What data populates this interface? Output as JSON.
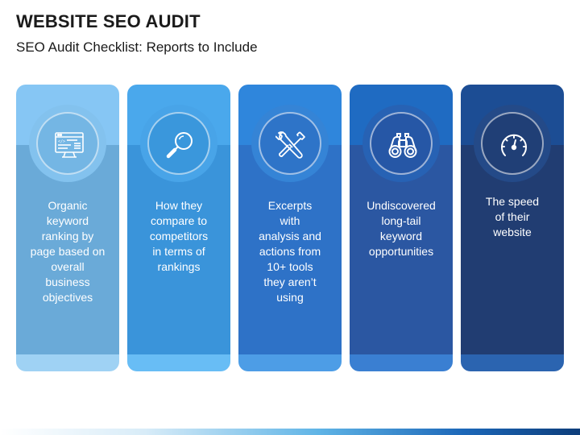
{
  "header": {
    "title": "WEBSITE SEO AUDIT",
    "subtitle": "SEO Audit Checklist: Reports to Include"
  },
  "cards": [
    {
      "text": "Organic\nkeyword\nranking by\npage based on\noverall\nbusiness\nobjectives",
      "icon": "web-code-report-icon",
      "colors": {
        "top": "#86c6f4",
        "body": "#6aaad8",
        "foot": "#9fd2f4",
        "ring": "#83c2ee",
        "circle": "#74b6e4"
      }
    },
    {
      "text": "How they\ncompare to\ncompetitors\nin terms of\nrankings",
      "icon": "magnifier-icon",
      "colors": {
        "top": "#4aa8ec",
        "body": "#3a94da",
        "foot": "#68bdf5",
        "ring": "#48a4e8",
        "circle": "#3a97dc"
      }
    },
    {
      "text": "Excerpts\nwith\nanalysis and\nactions from\n10+ tools\nthey aren’t\nusing",
      "icon": "wrench-screwdriver-icon",
      "colors": {
        "top": "#2f86dc",
        "body": "#2e72c7",
        "foot": "#4d9de6",
        "ring": "#3584d6",
        "circle": "#2e74c8"
      }
    },
    {
      "text": "Undiscovered\nlong-tail\nkeyword\nopportunities",
      "icon": "binoculars-icon",
      "colors": {
        "top": "#1f6bc2",
        "body": "#2b57a2",
        "foot": "#3a7fd2",
        "ring": "#2762b4",
        "circle": "#2657a6"
      }
    },
    {
      "text": "The speed\nof their\nwebsite",
      "icon": "speedometer-icon",
      "colors": {
        "top": "#1c4d94",
        "body": "#213d72",
        "foot": "#2b64b0",
        "ring": "#244a88",
        "circle": "#203f76"
      }
    }
  ]
}
